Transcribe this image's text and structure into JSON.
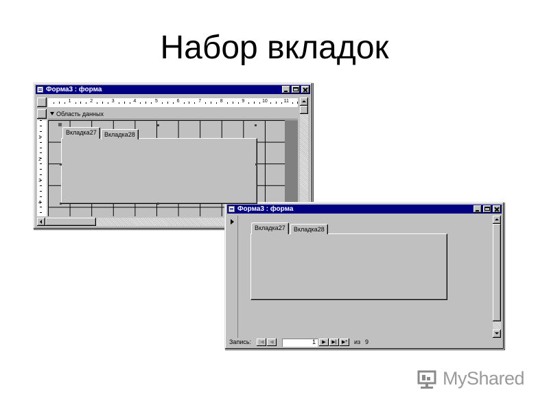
{
  "slide": {
    "title": "Набор вкладок"
  },
  "design_window": {
    "title": "Форма3 : форма",
    "section_label": "Область данных",
    "ruler_numbers": [
      "1",
      "2",
      "3",
      "4",
      "5",
      "6",
      "7",
      "8",
      "9",
      "10",
      "11"
    ],
    "vruler_numbers": [
      "1",
      "2",
      "3",
      "4"
    ],
    "tabs": [
      "Вкладка27",
      "Вкладка28"
    ]
  },
  "form_window": {
    "title": "Форма3 : форма",
    "tabs": [
      "Вкладка27",
      "Вкладка28"
    ],
    "nav": {
      "record_label": "Запись:",
      "current_record": "1",
      "of_label": "из",
      "total": "9"
    }
  },
  "logo": {
    "text": "MyShared"
  },
  "colors": {
    "titlebar": "#000080",
    "face": "#c0c0c0",
    "dark_area": "#808080"
  }
}
